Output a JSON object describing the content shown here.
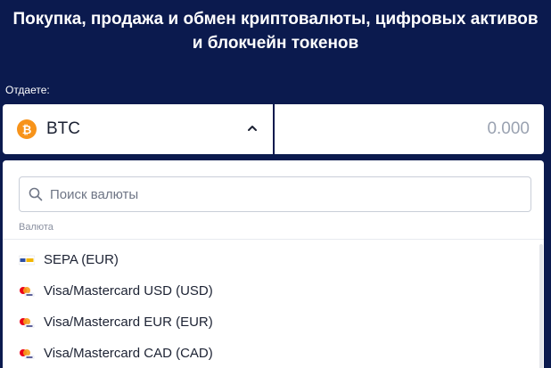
{
  "header": {
    "title_line1": "Покупка, продажа и обмен криптовалюты, цифровых активов",
    "title_line2": "и блокчейн токенов"
  },
  "give": {
    "label": "Отдаете:",
    "currency_code": "BTC",
    "currency_icon": "bitcoin-icon",
    "amount_placeholder": "0.000"
  },
  "dropdown": {
    "search_placeholder": "Поиск валюты",
    "section_label": "Валюта",
    "items": [
      {
        "label": "SEPA (EUR)",
        "icon": "sepa-icon"
      },
      {
        "label": "Visa/Mastercard USD (USD)",
        "icon": "visa-mastercard-icon"
      },
      {
        "label": "Visa/Mastercard EUR (EUR)",
        "icon": "visa-mastercard-icon"
      },
      {
        "label": "Visa/Mastercard CAD (CAD)",
        "icon": "visa-mastercard-icon"
      }
    ]
  },
  "colors": {
    "background": "#0b1a4e",
    "bitcoin": "#f7931a",
    "mastercard_red": "#eb001b",
    "mastercard_yellow": "#f79e1b",
    "visa_blue": "#1a1f71"
  }
}
